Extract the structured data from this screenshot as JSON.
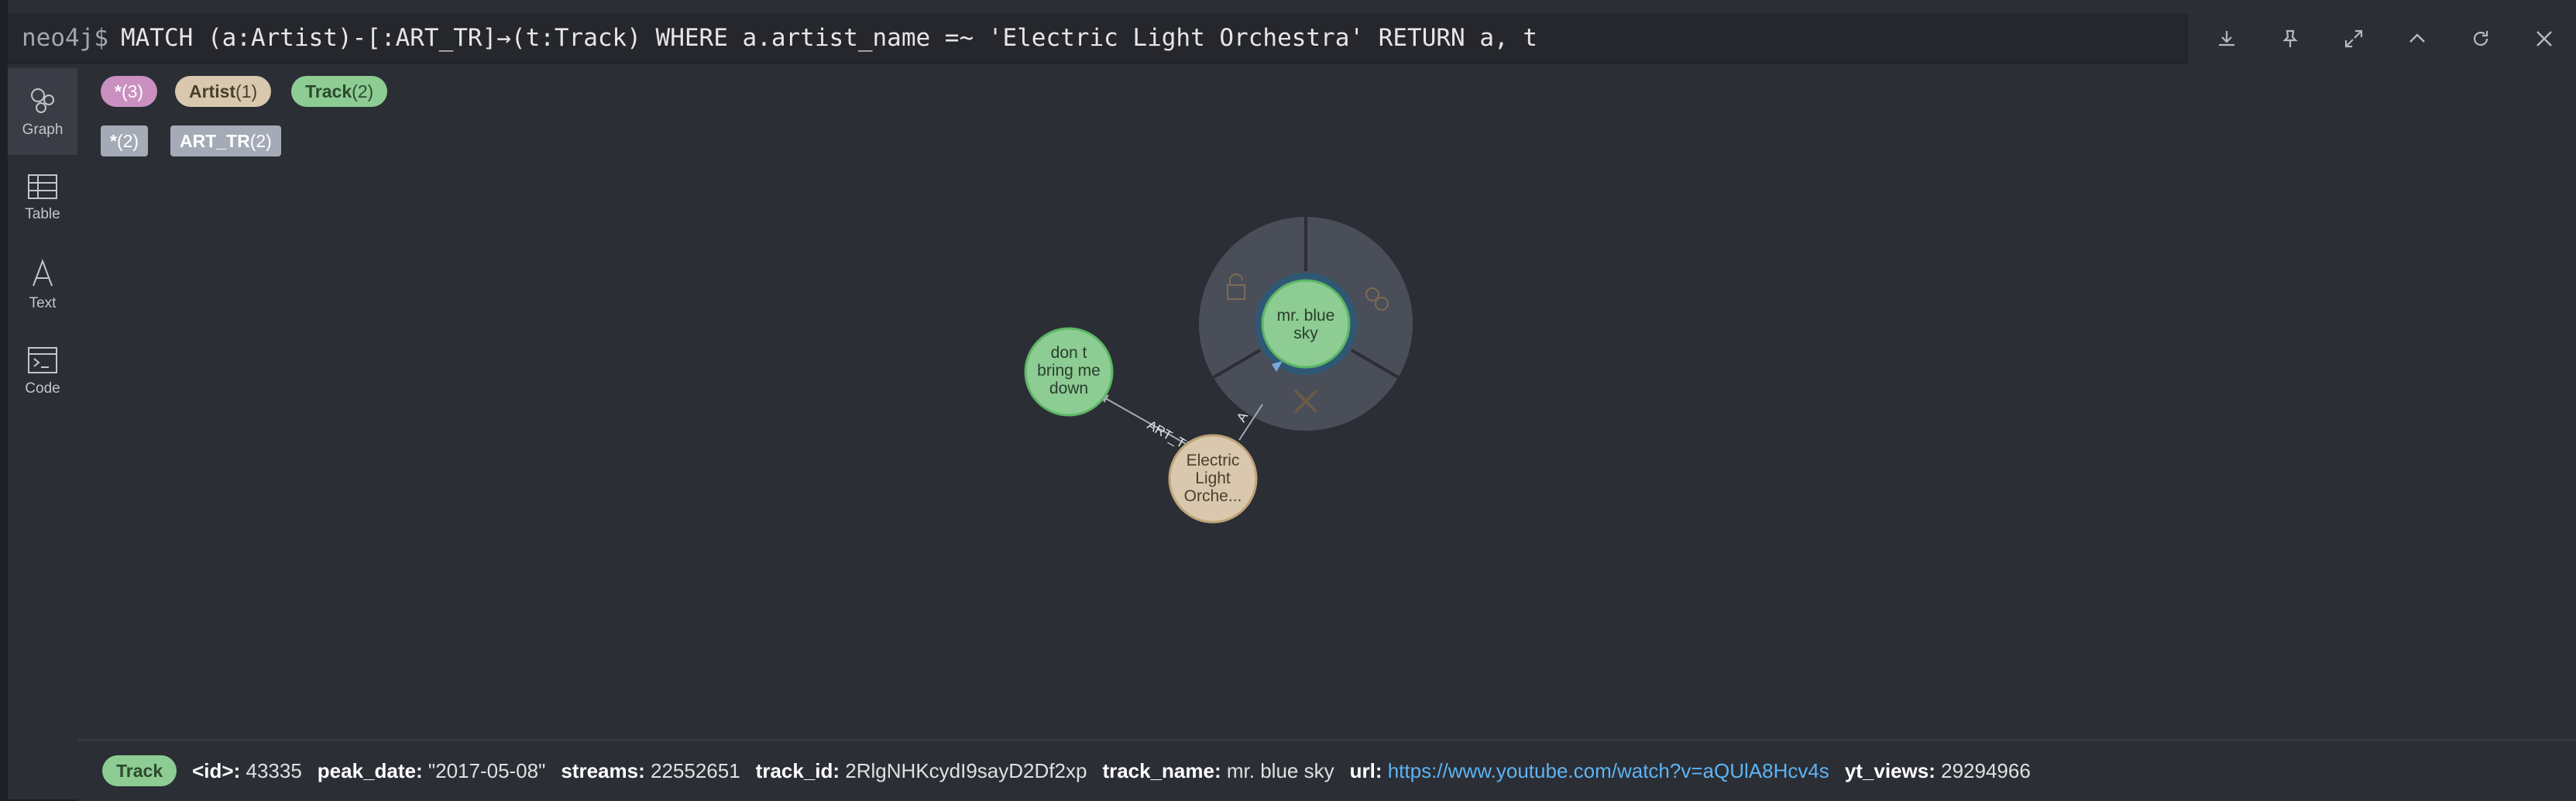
{
  "query": {
    "prompt": "neo4j$",
    "text": "MATCH (a:Artist)-[:ART_TR]→(t:Track) WHERE a.artist_name =~ 'Electric Light Orchestra' RETURN a, t"
  },
  "top_actions": [
    "download-icon",
    "pin-icon",
    "expand-icon",
    "collapse-icon",
    "refresh-icon",
    "close-icon"
  ],
  "sidebar": {
    "items": [
      {
        "label": "Graph",
        "icon": "graph-icon",
        "active": true
      },
      {
        "label": "Table",
        "icon": "table-icon",
        "active": false
      },
      {
        "label": "Text",
        "icon": "text-icon",
        "active": false
      },
      {
        "label": "Code",
        "icon": "code-icon",
        "active": false
      }
    ]
  },
  "legend": {
    "labels": [
      {
        "name": "*",
        "count": "(3)",
        "color": "#c990c0"
      },
      {
        "name": "Artist",
        "count": "(1)",
        "color": "#d9c8ae"
      },
      {
        "name": "Track",
        "count": "(2)",
        "color": "#8dcc93"
      }
    ],
    "relationships": [
      {
        "name": "*",
        "count": "(2)"
      },
      {
        "name": "ART_TR",
        "count": "(2)"
      }
    ]
  },
  "graph": {
    "nodes": [
      {
        "id": "track1",
        "label_lines": [
          "don t",
          "bring me",
          "down"
        ],
        "type": "Track",
        "color": "#8dcc93"
      },
      {
        "id": "track2",
        "label_lines": [
          "mr. blue",
          "sky"
        ],
        "type": "Track",
        "color": "#8dcc93",
        "selected": true
      },
      {
        "id": "artist",
        "label_lines": [
          "Electric",
          "Light",
          "Orche..."
        ],
        "type": "Artist",
        "color": "#d9c8ae"
      }
    ],
    "relationships": [
      {
        "from": "artist",
        "to": "track1",
        "type": "ART_TR"
      },
      {
        "from": "artist",
        "to": "track2",
        "type": "ART_TR",
        "label_visible": "A"
      }
    ]
  },
  "details": {
    "label": "Track",
    "props": [
      {
        "key": "<id>:",
        "value": "43335"
      },
      {
        "key": "peak_date:",
        "value": "\"2017-05-08\""
      },
      {
        "key": "streams:",
        "value": "22552651"
      },
      {
        "key": "track_id:",
        "value": "2RlgNHKcydI9sayD2Df2xp"
      },
      {
        "key": "track_name:",
        "value": "mr. blue sky"
      },
      {
        "key": "url:",
        "value": "https://www.youtube.com/watch?v=aQUlA8Hcv4s",
        "link": true
      },
      {
        "key": "yt_views:",
        "value": "29294966"
      }
    ]
  }
}
